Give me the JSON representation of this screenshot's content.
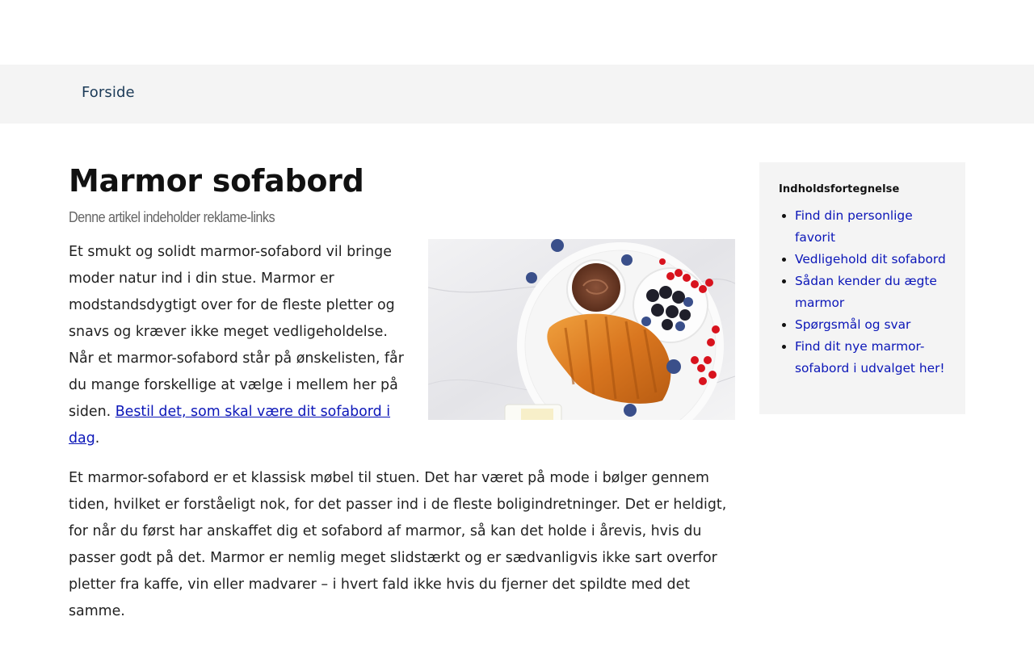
{
  "nav": {
    "home_label": "Forside"
  },
  "article": {
    "title": "Marmor sofabord",
    "ad_note": "Denne artikel indeholder reklame-links",
    "intro_text": "Et smukt og solidt marmor-sofabord vil bringe moder natur ind i din stue. Marmor er modstandsdygtigt over for de fleste pletter og snavs og kræver ikke meget vedligeholdelse. Når et marmor-sofabord står på ønskelisten, får du mange forskellige at vælge i mellem her på siden.",
    "intro_link": "Bestil det, som skal være dit sofabord i dag",
    "intro_end": ".",
    "paragraph2": "Et marmor-sofabord er et klassisk møbel til stuen. Det har været på mode i bølger gennem tiden, hvilket er forståeligt nok, for det passer ind i de fleste boligindretninger. Det er heldigt, for når du først har anskaffet dig et sofabord af marmor, så kan det holde i årevis, hvis du passer godt på det. Marmor er nemlig meget slidstærkt og er sædvanligvis ikke sart overfor pletter fra kaffe, vin eller madvarer – i hvert fald ikke hvis du fjerner det spildte med det samme."
  },
  "toc": {
    "title": "Indholdsfortegnelse",
    "items": [
      {
        "label": "Find din personlige favorit"
      },
      {
        "label": "Vedligehold dit sofabord"
      },
      {
        "label": "Sådan kender du ægte marmor"
      },
      {
        "label": "Spørgsmål og svar"
      },
      {
        "label": "Find dit nye marmor-sofabord i udvalget her!"
      }
    ]
  },
  "colors": {
    "link": "#0b16b8",
    "nav_bg": "#f4f4f4",
    "nav_text": "#1b3a57",
    "toc_bg": "#f4f4f4"
  }
}
